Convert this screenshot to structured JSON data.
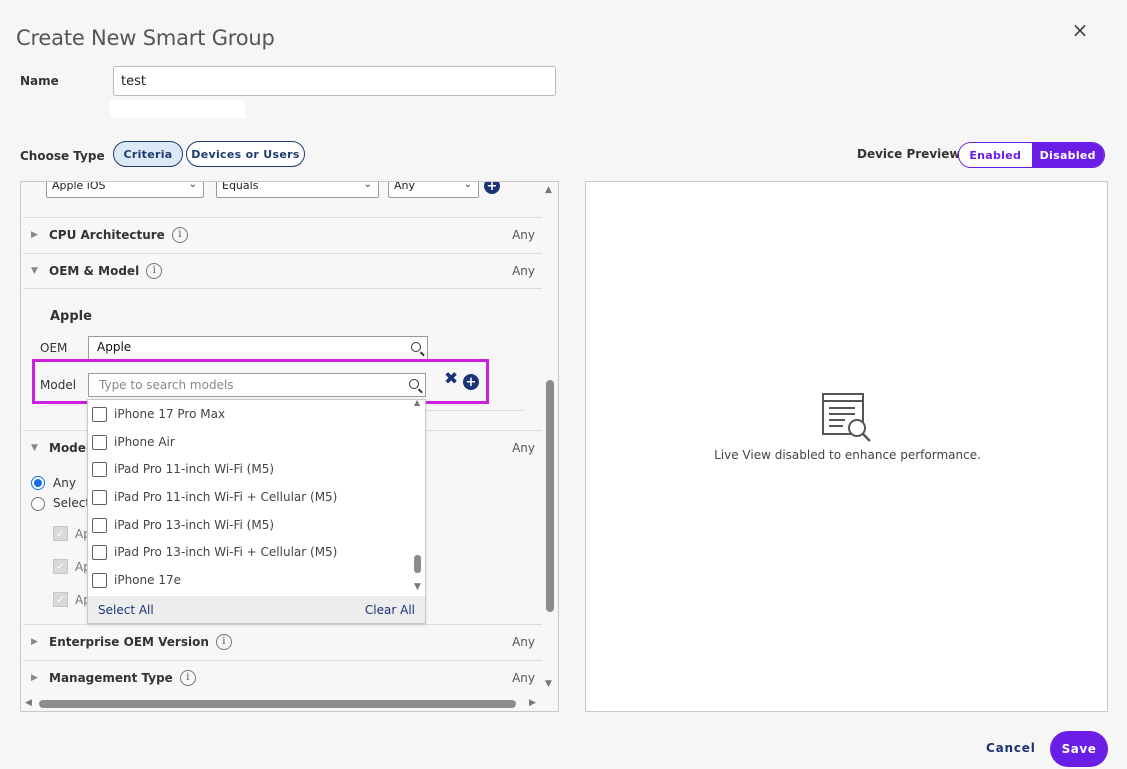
{
  "dialog": {
    "title": "Create New Smart Group",
    "close_icon": "×"
  },
  "name_field": {
    "label": "Name",
    "value": "test"
  },
  "choose_type": {
    "label": "Choose Type",
    "options": [
      "Criteria",
      "Devices or Users"
    ],
    "selected": "Criteria"
  },
  "device_preview": {
    "label": "Device Preview",
    "options": [
      "Enabled",
      "Disabled"
    ],
    "selected": "Disabled",
    "message": "Live View disabled to enhance performance."
  },
  "top_filter_row": {
    "platform": "Apple iOS",
    "operator": "Equals",
    "value": "Any"
  },
  "sections": [
    {
      "label": "CPU Architecture",
      "value": "Any",
      "expanded": false
    },
    {
      "label": "OEM & Model",
      "value": "Any",
      "expanded": true
    },
    {
      "label": "Model",
      "value": "Any",
      "expanded": true
    },
    {
      "label": "Enterprise OEM Version",
      "value": "Any",
      "expanded": false
    },
    {
      "label": "Management Type",
      "value": "Any",
      "expanded": false
    }
  ],
  "oem_model": {
    "group_heading": "Apple",
    "oem_label": "OEM",
    "oem_value": "Apple",
    "model_label": "Model",
    "model_placeholder": "Type to search models"
  },
  "model_radio": {
    "any_label": "Any",
    "select_label": "Select",
    "checked_items": [
      "Ap",
      "Ap",
      "Ap"
    ]
  },
  "model_dropdown": {
    "items": [
      "iPhone 17 Pro Max",
      "iPhone Air",
      "iPad Pro 11-inch Wi-Fi (M5)",
      "iPad Pro 11-inch Wi-Fi + Cellular (M5)",
      "iPad Pro 13-inch Wi-Fi (M5)",
      "iPad Pro 13-inch Wi-Fi + Cellular (M5)",
      "iPhone 17e"
    ],
    "select_all": "Select All",
    "clear_all": "Clear All"
  },
  "footer": {
    "cancel": "Cancel",
    "save": "Save"
  },
  "colors": {
    "accent_purple": "#6a1ee6",
    "navy": "#1b3477",
    "highlight": "#cc1fe0"
  }
}
